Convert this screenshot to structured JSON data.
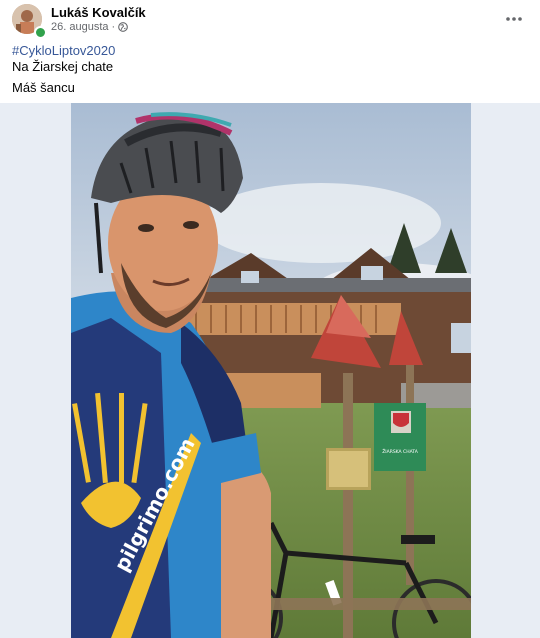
{
  "post": {
    "author": "Lukáš Kovalčík",
    "date": "26. augusta",
    "dot": "·",
    "hashtag": "#CykloLiptov2020",
    "line1": "Na Žiarskej chate",
    "line2": "Máš šancu",
    "more_icon": "more-horizontal-icon",
    "privacy_icon": "globe-icon"
  },
  "photo": {
    "jersey_text": "pilgrimo.com",
    "sign_text": "ŽIARSKA CHATA"
  },
  "colors": {
    "link": "#385898",
    "online": "#31a24c",
    "secondary_text": "#65676b"
  }
}
